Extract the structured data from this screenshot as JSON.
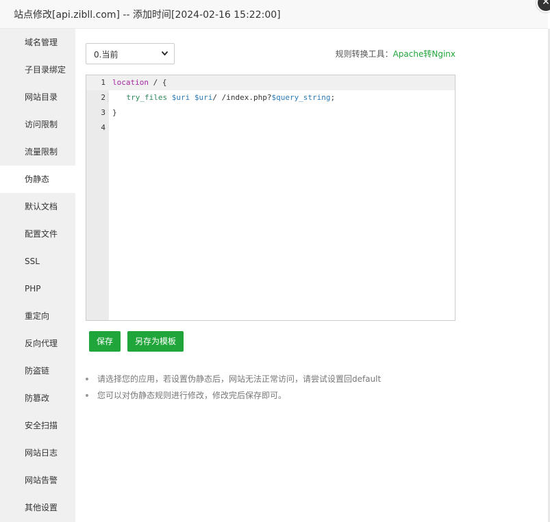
{
  "window": {
    "title": "站点修改[api.zibll.com] -- 添加时间[2024-02-16 15:22:00]",
    "close_icon": "✕"
  },
  "sidebar": {
    "items": [
      {
        "label": "域名管理",
        "active": false
      },
      {
        "label": "子目录绑定",
        "active": false
      },
      {
        "label": "网站目录",
        "active": false
      },
      {
        "label": "访问限制",
        "active": false
      },
      {
        "label": "流量限制",
        "active": false
      },
      {
        "label": "伪静态",
        "active": true
      },
      {
        "label": "默认文档",
        "active": false
      },
      {
        "label": "配置文件",
        "active": false
      },
      {
        "label": "SSL",
        "active": false
      },
      {
        "label": "PHP",
        "active": false
      },
      {
        "label": "重定向",
        "active": false
      },
      {
        "label": "反向代理",
        "active": false
      },
      {
        "label": "防盗链",
        "active": false
      },
      {
        "label": "防篡改",
        "active": false
      },
      {
        "label": "安全扫描",
        "active": false
      },
      {
        "label": "网站日志",
        "active": false
      },
      {
        "label": "网站告警",
        "active": false
      },
      {
        "label": "其他设置",
        "active": false
      }
    ]
  },
  "main": {
    "template_select": {
      "value": "0.当前",
      "chevron_icon": "chevron-down-icon"
    },
    "tool_label": "规则转换工具：",
    "tool_link": "Apache转Nginx",
    "editor": {
      "line_numbers": [
        "1",
        "2",
        "3",
        "4"
      ],
      "line1": {
        "kw": "location",
        "rest": " / {"
      },
      "line2": {
        "fn": "try_files",
        "sp1": " ",
        "var1": "$uri",
        "sp2": " ",
        "var2": "$uri",
        "mid": "/ /index.php?",
        "var3": "$query_string",
        "end": ";"
      },
      "line3": "}",
      "line4": ""
    },
    "save_button": "保存",
    "save_template_button": "另存为模板",
    "tips": [
      "请选择您的应用，若设置伪静态后，网站无法正常访问，请尝试设置回default",
      "您可以对伪静态规则进行修改，修改完后保存即可。"
    ]
  },
  "colors": {
    "accent": "#20a53a",
    "sidebar_bg": "#f0f0f0",
    "keyword": "#a626a4",
    "variable": "#2b7bb9"
  }
}
